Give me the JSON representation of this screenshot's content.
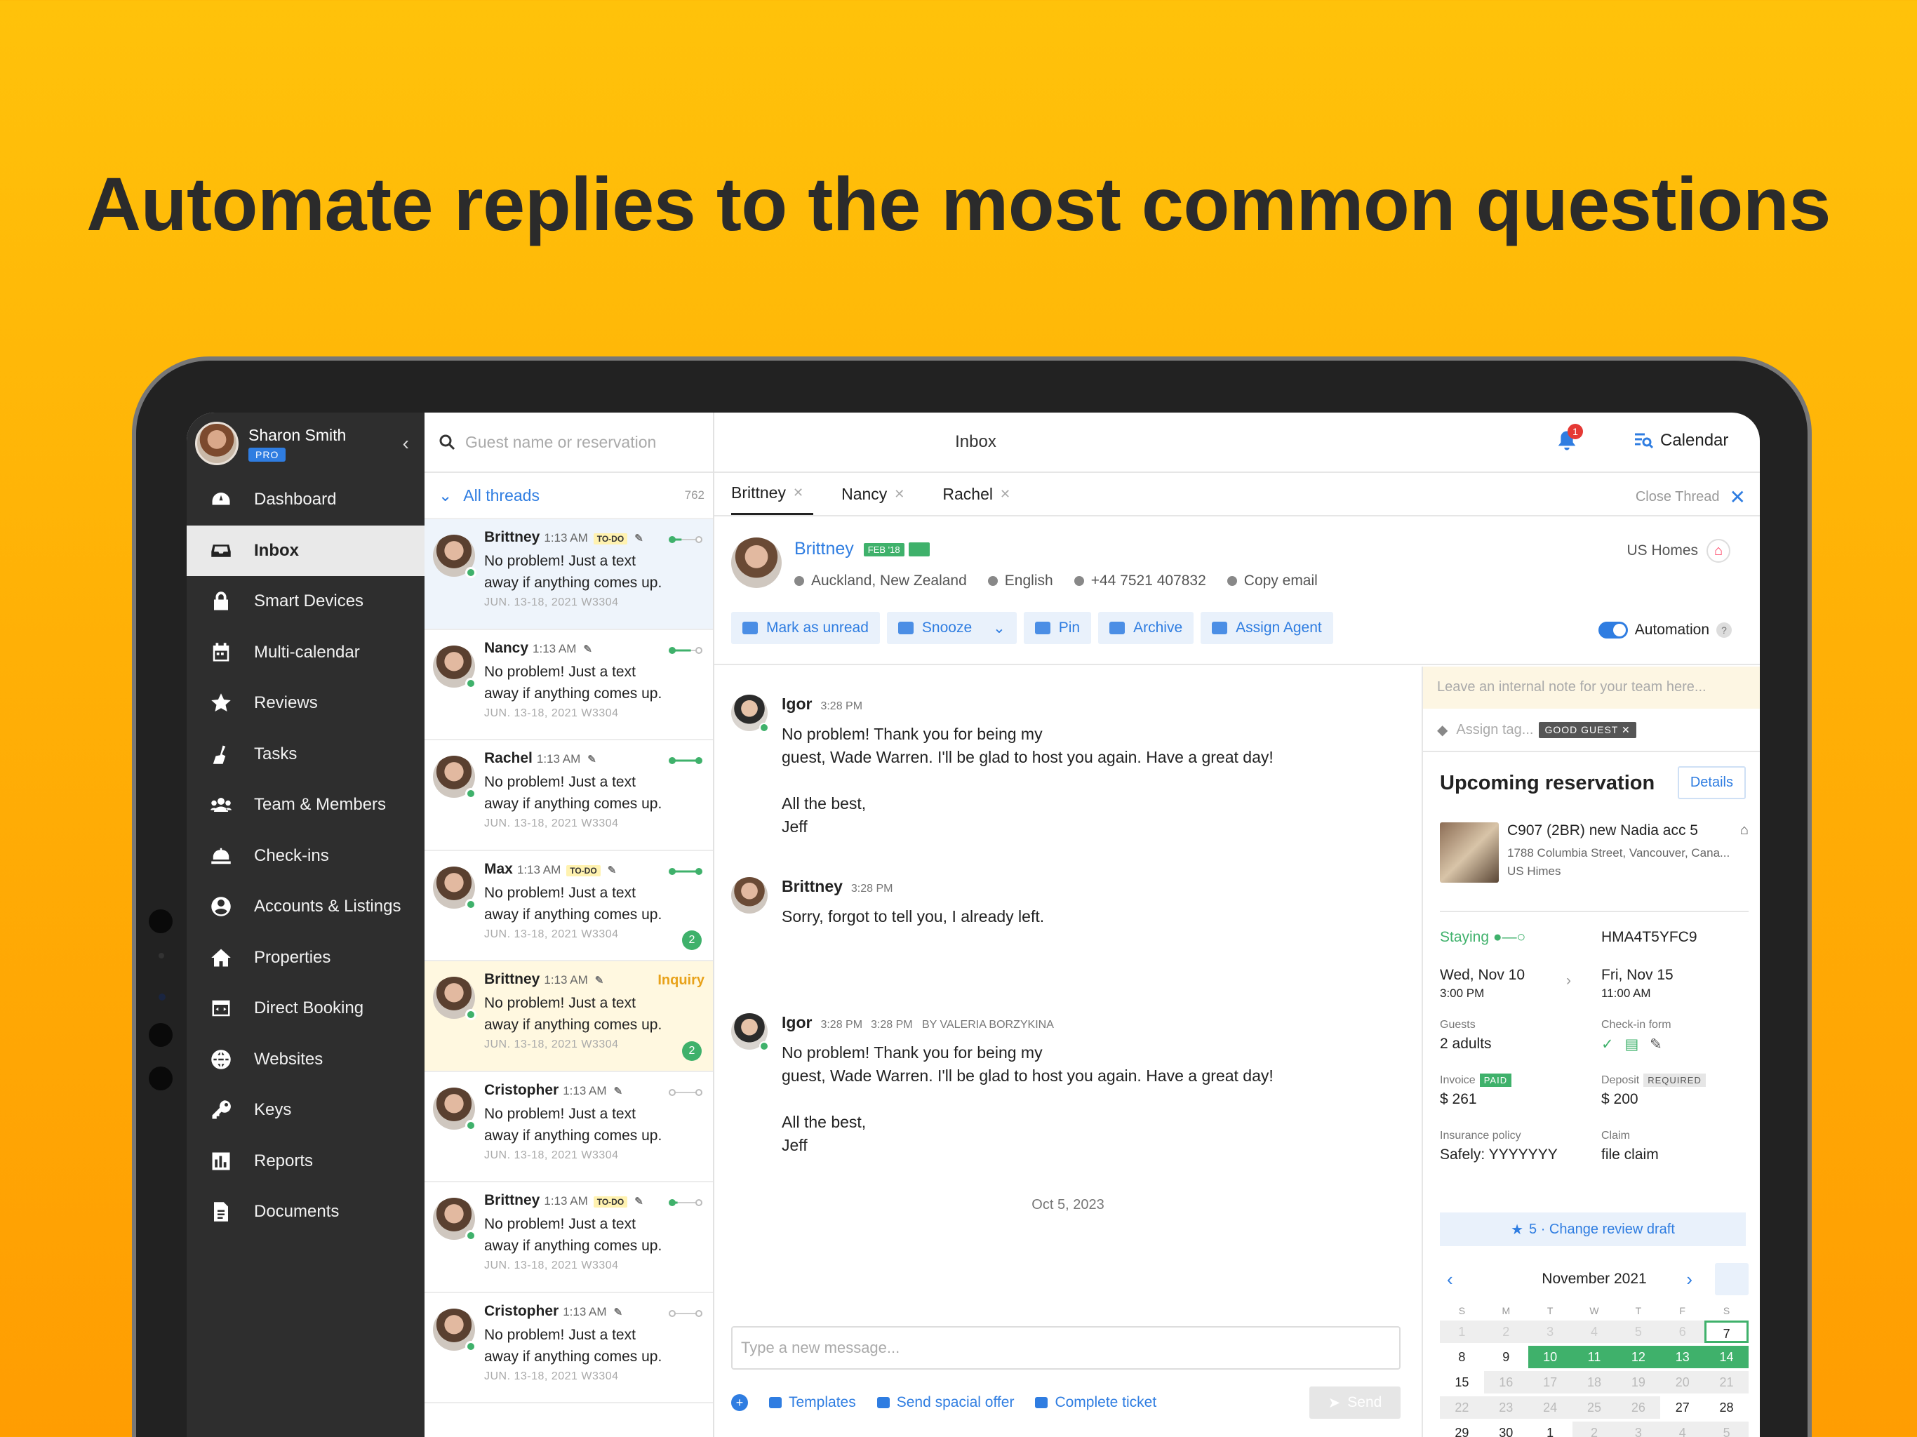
{
  "headline": "Automate replies to the most common questions",
  "colors": {
    "accent": "#2f7de1",
    "green": "#3fb16b",
    "sidebar": "#2e2e2e"
  },
  "profile": {
    "name": "Sharon Smith",
    "badge": "PRO"
  },
  "nav": [
    {
      "label": "Dashboard",
      "icon": "dashboard-icon"
    },
    {
      "label": "Inbox",
      "icon": "inbox-icon"
    },
    {
      "label": "Smart Devices",
      "icon": "lock-icon"
    },
    {
      "label": "Multi-calendar",
      "icon": "calendar-icon"
    },
    {
      "label": "Reviews",
      "icon": "star-icon"
    },
    {
      "label": "Tasks",
      "icon": "broom-icon"
    },
    {
      "label": "Team & Members",
      "icon": "team-icon"
    },
    {
      "label": "Check-ins",
      "icon": "bell-desk-icon"
    },
    {
      "label": "Accounts & Listings",
      "icon": "account-icon"
    },
    {
      "label": "Properties",
      "icon": "home-icon"
    },
    {
      "label": "Direct Booking",
      "icon": "code-window-icon"
    },
    {
      "label": "Websites",
      "icon": "globe-icon"
    },
    {
      "label": "Keys",
      "icon": "key-icon"
    },
    {
      "label": "Reports",
      "icon": "bar-chart-icon"
    },
    {
      "label": "Documents",
      "icon": "document-icon"
    }
  ],
  "search": {
    "placeholder": "Guest name or reservation"
  },
  "threads_header": {
    "label": "All threads",
    "count": "762"
  },
  "threads": [
    {
      "name": "Brittney",
      "time": "1:13 AM",
      "todo": "TO-DO",
      "text": "No problem! Just a text away if anything comes up.",
      "date": "JUN. 13-18, 2021 W3304"
    },
    {
      "name": "Nancy",
      "time": "1:13 AM",
      "todo": "",
      "text": "No problem! Just a text away if anything comes up.",
      "date": "JUN. 13-18, 2021 W3304"
    },
    {
      "name": "Rachel",
      "time": "1:13 AM",
      "todo": "",
      "text": "No problem! Just a text away if anything comes up.",
      "date": "JUN. 13-18, 2021 W3304"
    },
    {
      "name": "Max",
      "time": "1:13 AM",
      "todo": "TO-DO",
      "text": "No problem! Just a text away if anything comes up.",
      "date": "JUN. 13-18, 2021 W3304",
      "badge": "2"
    },
    {
      "name": "Brittney",
      "time": "1:13 AM",
      "todo": "",
      "text": "No problem! Just a text away if anything comes up.",
      "date": "JUN. 13-18, 2021 W3304",
      "badge": "2",
      "tag": "Inquiry"
    },
    {
      "name": "Cristopher",
      "time": "1:13 AM",
      "todo": "",
      "text": "No problem! Just a text away if anything comes up.",
      "date": "JUN. 13-18, 2021 W3304"
    },
    {
      "name": "Brittney",
      "time": "1:13 AM",
      "todo": "TO-DO",
      "text": "No problem! Just a text away if anything comes up.",
      "date": "JUN. 13-18, 2021 W3304"
    },
    {
      "name": "Cristopher",
      "time": "1:13 AM",
      "todo": "",
      "text": "No problem! Just a text away if anything comes up.",
      "date": "JUN. 13-18, 2021 W3304"
    }
  ],
  "topbar": {
    "title": "Inbox",
    "notif_count": "1",
    "calendar": "Calendar"
  },
  "tabs": [
    "Brittney",
    "Nancy",
    "Rachel"
  ],
  "close_thread": "Close Thread",
  "guest": {
    "name": "Brittney",
    "since": "FEB '18",
    "location": "Auckland, New Zealand",
    "language": "English",
    "phone": "+44 7521 407832",
    "email": "Copy email",
    "listing_group": "US Homes"
  },
  "actions": [
    "Mark as unread",
    "Snooze",
    "Pin",
    "Archive",
    "Assign Agent"
  ],
  "automation": {
    "label": "Automation",
    "help": "?"
  },
  "messages": [
    {
      "name": "Igor",
      "time": "3:28 PM",
      "meta": "",
      "body": "No problem! Thank you for being my\nguest, Wade Warren. I'll be glad to host you again. Have a great day!\n\nAll the best,\nJeff"
    },
    {
      "name": "Brittney",
      "time": "3:28 PM",
      "meta": "",
      "body": "Sorry, forgot to tell you, I already left."
    },
    {
      "name": "Igor",
      "time": "3:28 PM",
      "meta": "3:28 PM   BY VALERIA BORZYKINA",
      "body": "No problem! Thank you for being my\nguest, Wade Warren. I'll be glad to host you again. Have a great day!\n\nAll the best,\nJeff"
    }
  ],
  "date_separator": "Oct 5, 2023",
  "composer": {
    "placeholder": "Type a new message...",
    "templates": "Templates",
    "offer": "Send spacial offer",
    "ticket": "Complete ticket",
    "send": "Send"
  },
  "note": {
    "placeholder": "Leave an internal note for your team here...",
    "tag_placeholder": "Assign tag...",
    "tag": "GOOD GUEST ✕"
  },
  "reservation": {
    "heading": "Upcoming reservation",
    "details": "Details",
    "property": "C907 (2BR) new Nadia acc 5",
    "address": "1788 Columbia Street, Vancouver, Cana...",
    "owner": "US Himes",
    "status": "Staying",
    "code": "HMA4T5YFC9",
    "checkin_date": "Wed, Nov 10",
    "checkin_time": "3:00 PM",
    "checkout_date": "Fri, Nov 15",
    "checkout_time": "11:00 AM",
    "guests_label": "Guests",
    "guests": "2 adults",
    "checkin_form_label": "Check-in form",
    "invoice_label": "Invoice",
    "invoice_status": "PAID",
    "invoice": "$ 261",
    "deposit_label": "Deposit",
    "deposit_status": "REQUIRED",
    "deposit": "$ 200",
    "insurance_label": "Insurance policy",
    "insurance": "Safely: YYYYYYY",
    "claim_label": "Claim",
    "claim": "file claim",
    "review": "5 · Change review draft"
  },
  "calendar": {
    "month": "November 2021",
    "dow": [
      "S",
      "M",
      "T",
      "W",
      "T",
      "F",
      "S"
    ],
    "days": [
      "1",
      "2",
      "3",
      "4",
      "5",
      "6",
      "7",
      "8",
      "9",
      "10",
      "11",
      "12",
      "13",
      "14",
      "15",
      "16",
      "17",
      "18",
      "19",
      "20",
      "21",
      "22",
      "23",
      "24",
      "25",
      "26",
      "27",
      "28",
      "29",
      "30",
      "1",
      "2",
      "3",
      "4",
      "5"
    ]
  }
}
